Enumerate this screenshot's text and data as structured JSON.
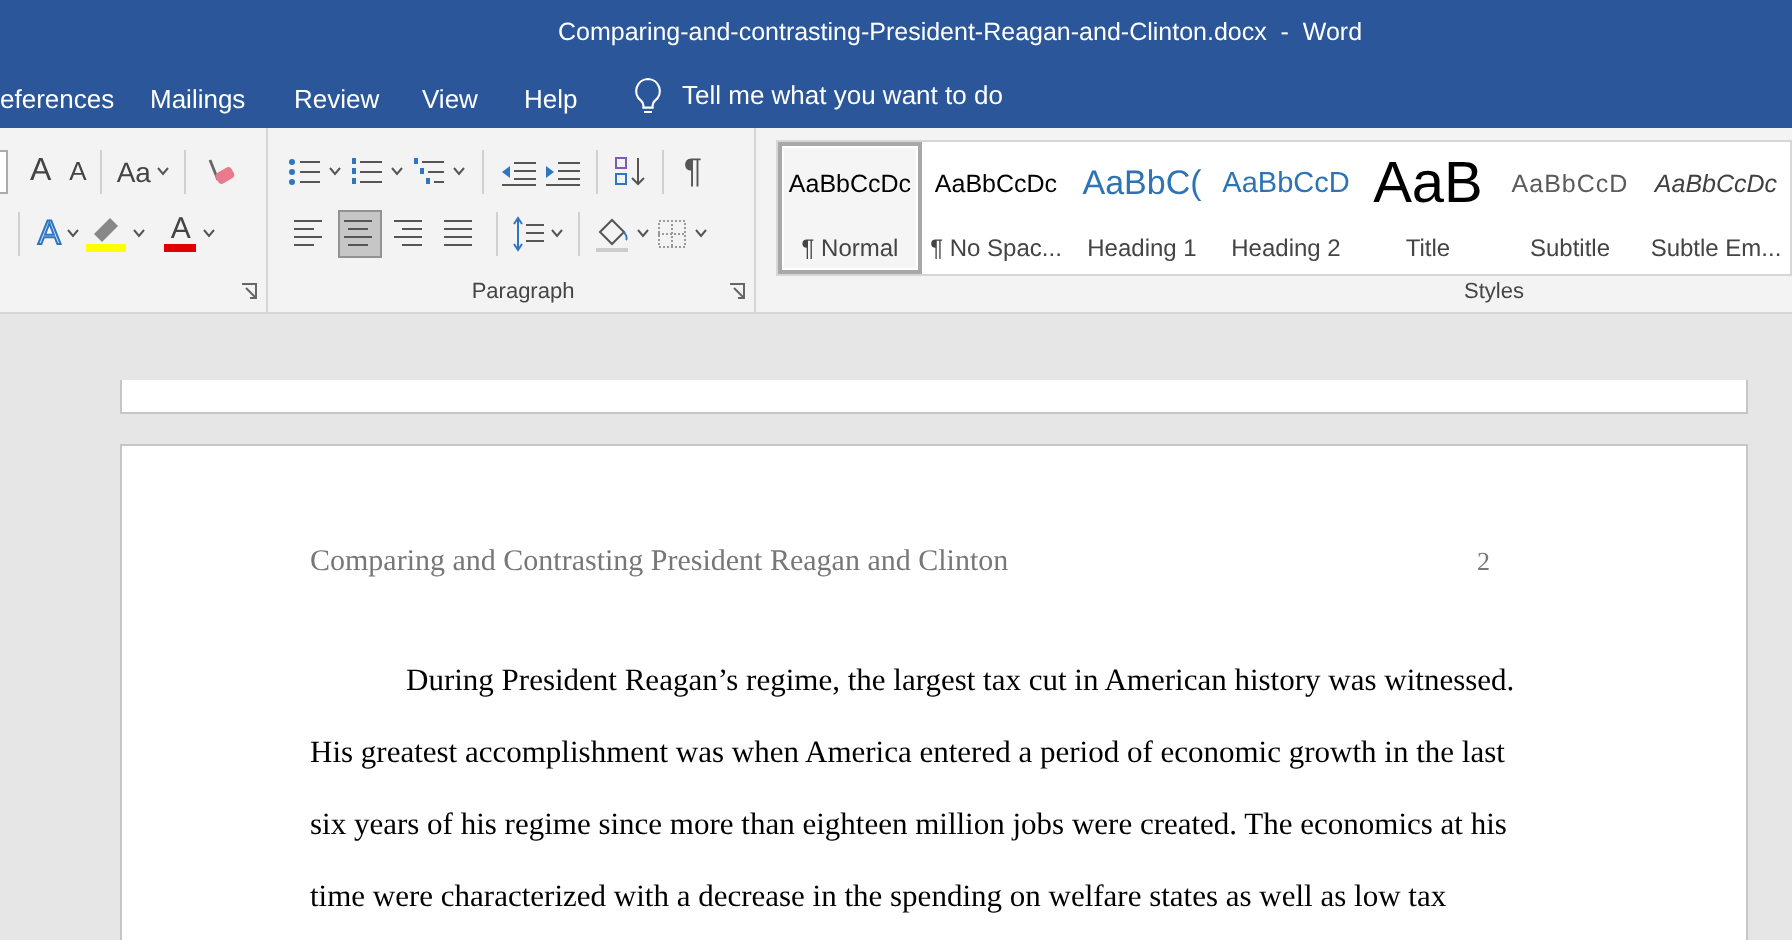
{
  "window": {
    "title": "Comparing-and-contrasting-President-Reagan-and-Clinton.docx  -  Word"
  },
  "tabs": [
    {
      "label": "eferences",
      "selected": false
    },
    {
      "label": "Mailings",
      "selected": false
    },
    {
      "label": "Review",
      "selected": false
    },
    {
      "label": "View",
      "selected": false
    },
    {
      "label": "Help",
      "selected": false
    }
  ],
  "tell_me": {
    "placeholder": "Tell me what you want to do"
  },
  "font_group": {
    "grow": "A",
    "shrink": "A",
    "change_case": "Aa",
    "text_effects": "A",
    "font_color": "A"
  },
  "paragraph_group": {
    "label": "Paragraph",
    "pilcrow": "¶",
    "alignments": [
      {
        "kind": "left",
        "selected": false
      },
      {
        "kind": "center",
        "selected": true
      },
      {
        "kind": "right",
        "selected": false
      },
      {
        "kind": "justify",
        "selected": false
      }
    ]
  },
  "styles_group": {
    "label": "Styles",
    "styles": [
      {
        "kind": "normal",
        "preview": "AaBbCcDc",
        "label": "¶ Normal",
        "selected": true
      },
      {
        "kind": "no_spacing",
        "preview": "AaBbCcDc",
        "label": "¶ No Spac...",
        "selected": false
      },
      {
        "kind": "heading1",
        "preview": "AaBbC(",
        "label": "Heading 1",
        "selected": false
      },
      {
        "kind": "heading2",
        "preview": "AaBbCcD",
        "label": "Heading 2",
        "selected": false
      },
      {
        "kind": "title",
        "preview": "AaB",
        "label": "Title",
        "selected": false
      },
      {
        "kind": "subtitle",
        "preview": "AaBbCcD",
        "label": "Subtitle",
        "selected": false
      },
      {
        "kind": "subtle_emphasis",
        "preview": "AaBbCcDc",
        "label": "Subtle Em...",
        "selected": false
      }
    ]
  },
  "document": {
    "header": "Comparing and Contrasting President Reagan and Clinton",
    "page_number": "2",
    "lines": [
      "During President Reagan’s regime, the largest tax cut in American history was witnessed.",
      "His greatest accomplishment was when America entered a period of economic growth in the last",
      "six years of his regime since more than eighteen million jobs were created. The economics at his",
      "time were characterized with a decrease in the spending on welfare states as well as low tax"
    ]
  }
}
